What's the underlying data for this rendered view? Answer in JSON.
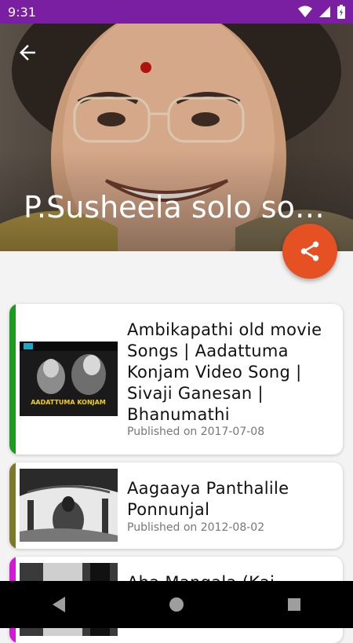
{
  "status_bar": {
    "time": "9:31",
    "icons": [
      "wifi-icon",
      "signal-icon",
      "battery-icon"
    ]
  },
  "header": {
    "title": "P.Susheela solo so…"
  },
  "actions": {
    "share_icon": "share-icon",
    "back_icon": "arrow-back-icon"
  },
  "videos": [
    {
      "title": "Ambikapathi old movie Songs | Aadattuma Konjam Video Song | Sivaji Ganesan | Bhanumathi",
      "date": "Published on 2017-07-08",
      "thumb_caption": "AADATTUMA KONJAM",
      "stripe_color": "#1e9a1e"
    },
    {
      "title": "Aagaaya Panthalile Ponnunjal",
      "date": "Published on 2012-08-02",
      "stripe_color": "#7c7a2a"
    },
    {
      "title": "Aha Mangala (Kai",
      "stripe_color": "#d11ad4"
    }
  ],
  "nav": {
    "back": "nav-back-icon",
    "home": "nav-home-icon",
    "recents": "nav-recents-icon"
  },
  "colors": {
    "status_bar": "#7b1fa2",
    "fab": "#e65124"
  }
}
